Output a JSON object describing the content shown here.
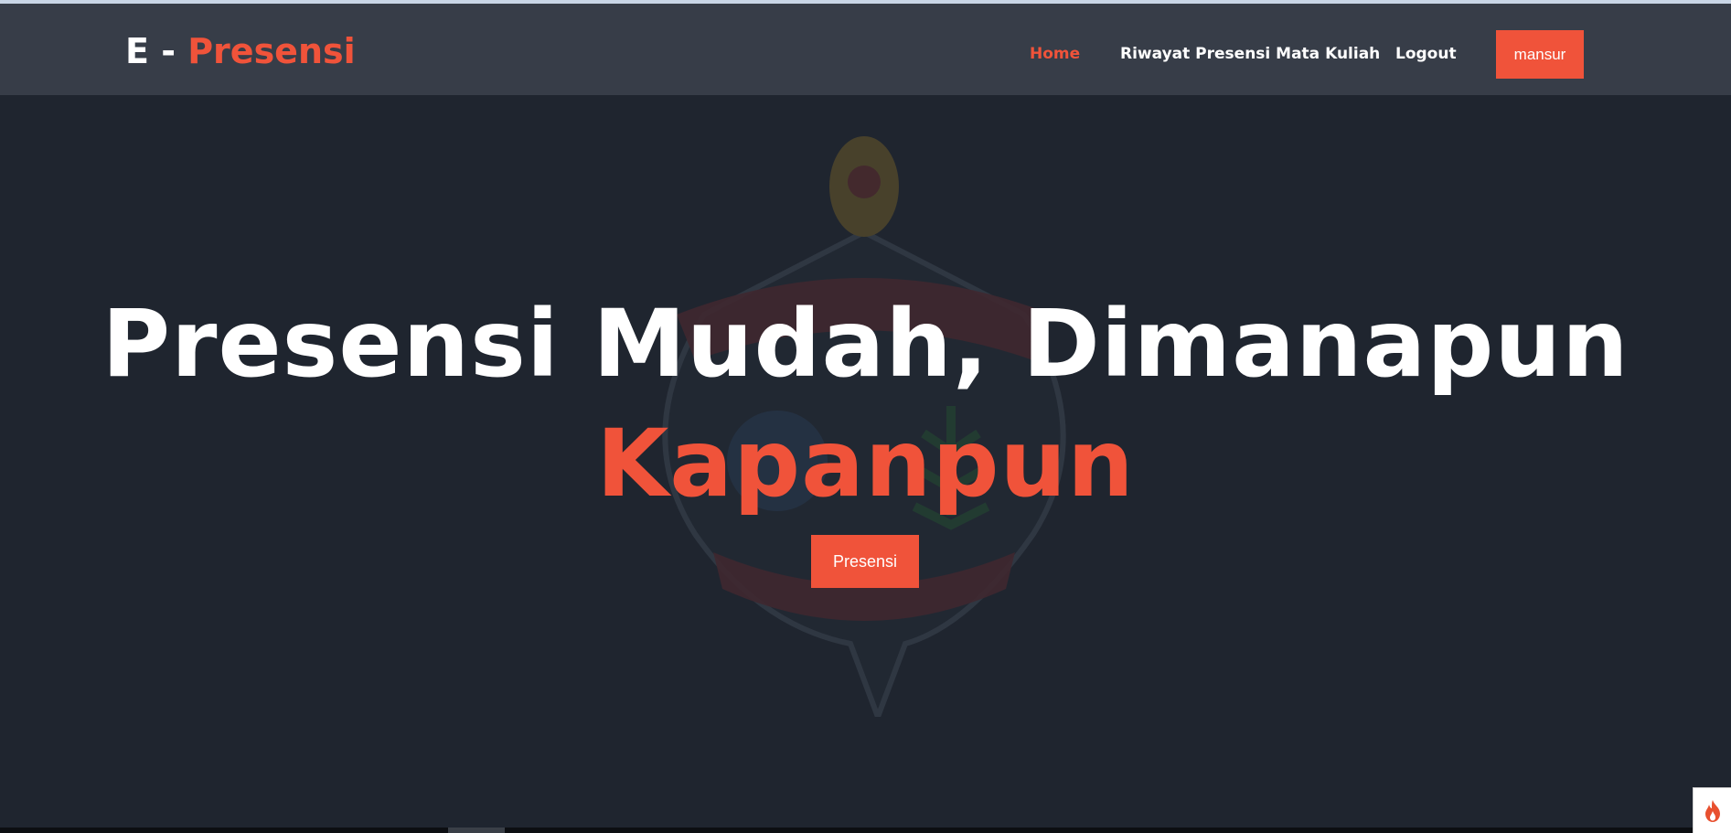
{
  "brand": {
    "prefix": "E - ",
    "accent": "Presensi"
  },
  "nav": {
    "home": "Home",
    "riwayat": "Riwayat Presensi Mata Kuliah",
    "logout": "Logout",
    "user": "mansur"
  },
  "hero": {
    "title_line1": "Presensi Mudah, Dimanapun",
    "title_line2": "Kapanpun",
    "cta": "Presensi"
  },
  "colors": {
    "accent": "#f0533a",
    "navbar": "#373d48",
    "background": "#1f252f"
  },
  "icons": {
    "corner_widget": "flame-icon",
    "hero_background": "academy-emblem"
  }
}
